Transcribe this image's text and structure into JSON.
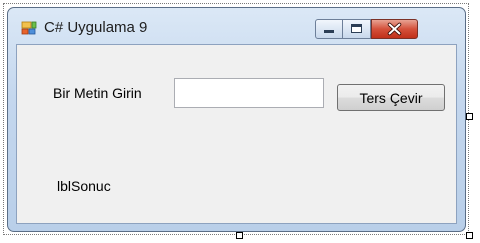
{
  "window": {
    "title": "C# Uygulama 9",
    "app_icon": "windows-forms-app-icon"
  },
  "controls": {
    "minimize_icon": "minimize-icon",
    "maximize_icon": "maximize-icon",
    "close_icon": "close-icon",
    "close_color": "#c1301a"
  },
  "form": {
    "prompt_label": "Bir Metin Girin",
    "text_input_value": "",
    "reverse_button_label": "Ters Çevir",
    "result_label": "lblSonuc"
  }
}
